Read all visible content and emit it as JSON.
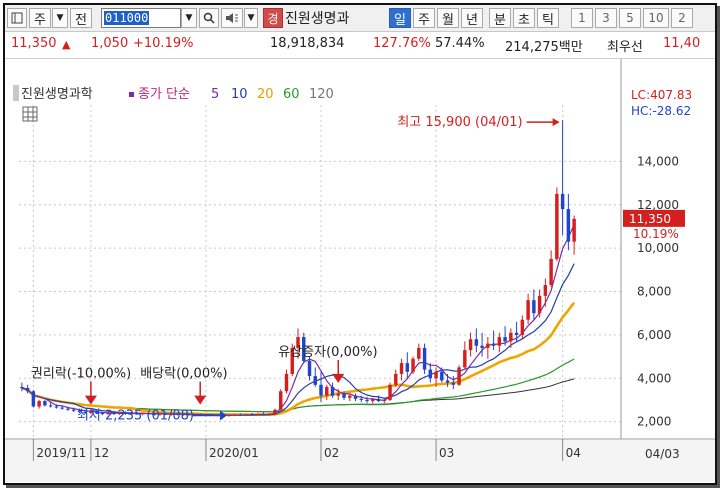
{
  "toolbar": {
    "market_label": "주",
    "mode_label": "전",
    "code_value": "011000",
    "stock_name_tag": "경",
    "stock_name": "진원생명과",
    "timeframes": [
      "일",
      "주",
      "월",
      "년",
      "분",
      "초",
      "틱"
    ],
    "active_timeframe": "일",
    "numbers": [
      "1",
      "3",
      "5",
      "10",
      "2"
    ]
  },
  "quote": {
    "price": "11,350",
    "change": "1,050",
    "change_pct": "+10.19%",
    "volume": "18,918,834",
    "vol_ratio": "127.76%",
    "turnover_pct": "57.44%",
    "trade_value": "214,275백만",
    "pref_label": "최우선",
    "pref_price": "11,40"
  },
  "colors": {
    "up": "#d41f1f",
    "down": "#1f45c8",
    "ma5": "#7a2ca8",
    "ma10": "#1f3fb0",
    "ma20": "#f0a500",
    "ma60": "#2a9a2a",
    "ma120": "#333333"
  },
  "chart_data": {
    "type": "candlestick",
    "title": "진원생명과학",
    "legend": {
      "price_label": "종가 단순",
      "periods": [
        "5",
        "10",
        "20",
        "60",
        "120"
      ]
    },
    "corner_labels": {
      "lc": "LC:407.83",
      "hc": "HC:-28.62"
    },
    "ylim": [
      1200,
      16600
    ],
    "y_ticks": [
      "2,000",
      "4,000",
      "6,000",
      "8,000",
      "10,000",
      "12,000",
      "14,000"
    ],
    "y_tick_values": [
      2000,
      4000,
      6000,
      8000,
      10000,
      12000,
      14000
    ],
    "x_labels": [
      "2019/11",
      "12",
      "2020/01",
      "02",
      "03",
      "04"
    ],
    "x_label_dates": [
      "2019-11-18",
      "2019-12-02",
      "2020-01-02",
      "2020-02-03",
      "2020-03-02",
      "2020-04-01"
    ],
    "right_date_label": "04/03",
    "last_price": "11,350",
    "last_change_pct": "10.19%",
    "last_close_value": 11350,
    "annotations": {
      "high": "최고 15,900 (04/01)",
      "low": "최저 2,235 (01/08)",
      "rights": "권리락(-10.00%)",
      "dividend": "배당락(0,00%)",
      "capital": "유상증자(0,00%)"
    },
    "event_values": {
      "rights": 3200,
      "dividend": 3200,
      "capital": 4200
    },
    "candles": [
      {
        "d": "2019-11-14",
        "o": 3600,
        "h": 3800,
        "l": 3400,
        "c": 3550
      },
      {
        "d": "2019-11-15",
        "o": 3550,
        "h": 3700,
        "l": 3300,
        "c": 3400
      },
      {
        "d": "2019-11-18",
        "o": 3400,
        "h": 3450,
        "l": 2650,
        "c": 2700
      },
      {
        "d": "2019-11-19",
        "o": 2700,
        "h": 3000,
        "l": 2600,
        "c": 2950
      },
      {
        "d": "2019-11-20",
        "o": 2950,
        "h": 3000,
        "l": 2700,
        "c": 2750
      },
      {
        "d": "2019-11-21",
        "o": 2750,
        "h": 2900,
        "l": 2650,
        "c": 2700
      },
      {
        "d": "2019-11-22",
        "o": 2700,
        "h": 2800,
        "l": 2600,
        "c": 2650
      },
      {
        "d": "2019-11-25",
        "o": 2650,
        "h": 2750,
        "l": 2550,
        "c": 2600
      },
      {
        "d": "2019-11-26",
        "o": 2600,
        "h": 2700,
        "l": 2500,
        "c": 2550
      },
      {
        "d": "2019-11-27",
        "o": 2550,
        "h": 2650,
        "l": 2450,
        "c": 2500
      },
      {
        "d": "2019-11-28",
        "o": 2500,
        "h": 2600,
        "l": 2400,
        "c": 2450
      },
      {
        "d": "2019-11-29",
        "o": 2450,
        "h": 2550,
        "l": 2350,
        "c": 2400
      },
      {
        "d": "2019-12-02",
        "o": 2400,
        "h": 2550,
        "l": 2350,
        "c": 2500
      },
      {
        "d": "2019-12-03",
        "o": 2500,
        "h": 2550,
        "l": 2350,
        "c": 2400
      },
      {
        "d": "2019-12-04",
        "o": 2400,
        "h": 2450,
        "l": 2300,
        "c": 2350
      },
      {
        "d": "2019-12-05",
        "o": 2350,
        "h": 2450,
        "l": 2300,
        "c": 2400
      },
      {
        "d": "2019-12-06",
        "o": 2400,
        "h": 2500,
        "l": 2300,
        "c": 2350
      },
      {
        "d": "2019-12-09",
        "o": 2350,
        "h": 2450,
        "l": 2300,
        "c": 2420
      },
      {
        "d": "2019-12-10",
        "o": 2420,
        "h": 2480,
        "l": 2320,
        "c": 2360
      },
      {
        "d": "2019-12-11",
        "o": 2360,
        "h": 2450,
        "l": 2300,
        "c": 2380
      },
      {
        "d": "2019-12-12",
        "o": 2380,
        "h": 2460,
        "l": 2310,
        "c": 2340
      },
      {
        "d": "2019-12-13",
        "o": 2340,
        "h": 2420,
        "l": 2290,
        "c": 2400
      },
      {
        "d": "2019-12-16",
        "o": 2400,
        "h": 2470,
        "l": 2320,
        "c": 2350
      },
      {
        "d": "2019-12-17",
        "o": 2350,
        "h": 2420,
        "l": 2280,
        "c": 2330
      },
      {
        "d": "2019-12-18",
        "o": 2330,
        "h": 2400,
        "l": 2270,
        "c": 2370
      },
      {
        "d": "2019-12-19",
        "o": 2370,
        "h": 2430,
        "l": 2300,
        "c": 2320
      },
      {
        "d": "2019-12-20",
        "o": 2320,
        "h": 2400,
        "l": 2280,
        "c": 2360
      },
      {
        "d": "2019-12-23",
        "o": 2360,
        "h": 2420,
        "l": 2290,
        "c": 2310
      },
      {
        "d": "2019-12-24",
        "o": 2310,
        "h": 2380,
        "l": 2260,
        "c": 2340
      },
      {
        "d": "2019-12-26",
        "o": 2340,
        "h": 2400,
        "l": 2280,
        "c": 2300
      },
      {
        "d": "2019-12-27",
        "o": 2300,
        "h": 2360,
        "l": 2250,
        "c": 2320
      },
      {
        "d": "2019-12-30",
        "o": 2320,
        "h": 2380,
        "l": 2260,
        "c": 2290
      },
      {
        "d": "2020-01-02",
        "o": 2290,
        "h": 2350,
        "l": 2250,
        "c": 2310
      },
      {
        "d": "2020-01-03",
        "o": 2310,
        "h": 2360,
        "l": 2260,
        "c": 2280
      },
      {
        "d": "2020-01-06",
        "o": 2280,
        "h": 2330,
        "l": 2250,
        "c": 2300
      },
      {
        "d": "2020-01-07",
        "o": 2300,
        "h": 2350,
        "l": 2250,
        "c": 2270
      },
      {
        "d": "2020-01-08",
        "o": 2270,
        "h": 2320,
        "l": 2235,
        "c": 2300
      },
      {
        "d": "2020-01-09",
        "o": 2300,
        "h": 2360,
        "l": 2260,
        "c": 2330
      },
      {
        "d": "2020-01-10",
        "o": 2330,
        "h": 2380,
        "l": 2280,
        "c": 2300
      },
      {
        "d": "2020-01-13",
        "o": 2300,
        "h": 2360,
        "l": 2270,
        "c": 2340
      },
      {
        "d": "2020-01-14",
        "o": 2340,
        "h": 2400,
        "l": 2290,
        "c": 2320
      },
      {
        "d": "2020-01-15",
        "o": 2320,
        "h": 2380,
        "l": 2280,
        "c": 2350
      },
      {
        "d": "2020-01-16",
        "o": 2350,
        "h": 2420,
        "l": 2300,
        "c": 2330
      },
      {
        "d": "2020-01-17",
        "o": 2330,
        "h": 2400,
        "l": 2290,
        "c": 2360
      },
      {
        "d": "2020-01-20",
        "o": 2360,
        "h": 2600,
        "l": 2320,
        "c": 2550
      },
      {
        "d": "2020-01-21",
        "o": 2550,
        "h": 3500,
        "l": 2500,
        "c": 3400
      },
      {
        "d": "2020-01-22",
        "o": 3400,
        "h": 4400,
        "l": 3300,
        "c": 4200
      },
      {
        "d": "2020-01-23",
        "o": 4200,
        "h": 5600,
        "l": 4100,
        "c": 5400
      },
      {
        "d": "2020-01-28",
        "o": 5400,
        "h": 6300,
        "l": 4900,
        "c": 5900
      },
      {
        "d": "2020-01-29",
        "o": 5900,
        "h": 6100,
        "l": 4700,
        "c": 4800
      },
      {
        "d": "2020-01-30",
        "o": 4800,
        "h": 5000,
        "l": 3900,
        "c": 4100
      },
      {
        "d": "2020-01-31",
        "o": 4100,
        "h": 4500,
        "l": 3600,
        "c": 3700
      },
      {
        "d": "2020-02-03",
        "o": 3700,
        "h": 4300,
        "l": 2900,
        "c": 3200
      },
      {
        "d": "2020-02-04",
        "o": 3200,
        "h": 3700,
        "l": 3000,
        "c": 3600
      },
      {
        "d": "2020-02-05",
        "o": 3600,
        "h": 3800,
        "l": 3100,
        "c": 3200
      },
      {
        "d": "2020-02-06",
        "o": 3200,
        "h": 3500,
        "l": 3000,
        "c": 3300
      },
      {
        "d": "2020-02-07",
        "o": 3300,
        "h": 3400,
        "l": 3000,
        "c": 3100
      },
      {
        "d": "2020-02-10",
        "o": 3100,
        "h": 3300,
        "l": 2950,
        "c": 3200
      },
      {
        "d": "2020-02-11",
        "o": 3200,
        "h": 3300,
        "l": 2950,
        "c": 3050
      },
      {
        "d": "2020-02-12",
        "o": 3050,
        "h": 3200,
        "l": 2900,
        "c": 3000
      },
      {
        "d": "2020-02-13",
        "o": 3000,
        "h": 3150,
        "l": 2850,
        "c": 2950
      },
      {
        "d": "2020-02-14",
        "o": 2950,
        "h": 3100,
        "l": 2850,
        "c": 3050
      },
      {
        "d": "2020-02-17",
        "o": 3050,
        "h": 3200,
        "l": 2900,
        "c": 2950
      },
      {
        "d": "2020-02-18",
        "o": 2950,
        "h": 3100,
        "l": 2850,
        "c": 3000
      },
      {
        "d": "2020-02-19",
        "o": 3000,
        "h": 3800,
        "l": 2950,
        "c": 3700
      },
      {
        "d": "2020-02-20",
        "o": 3700,
        "h": 4400,
        "l": 3600,
        "c": 4200
      },
      {
        "d": "2020-02-21",
        "o": 4200,
        "h": 4900,
        "l": 3900,
        "c": 4700
      },
      {
        "d": "2020-02-24",
        "o": 4700,
        "h": 5200,
        "l": 4000,
        "c": 4300
      },
      {
        "d": "2020-02-25",
        "o": 4300,
        "h": 5000,
        "l": 4200,
        "c": 4900
      },
      {
        "d": "2020-02-26",
        "o": 4900,
        "h": 5600,
        "l": 4800,
        "c": 5400
      },
      {
        "d": "2020-02-27",
        "o": 5400,
        "h": 5600,
        "l": 4200,
        "c": 4400
      },
      {
        "d": "2020-02-28",
        "o": 4400,
        "h": 4700,
        "l": 3800,
        "c": 4000
      },
      {
        "d": "2020-03-02",
        "o": 4000,
        "h": 4500,
        "l": 3600,
        "c": 4300
      },
      {
        "d": "2020-03-03",
        "o": 4300,
        "h": 4500,
        "l": 3800,
        "c": 3900
      },
      {
        "d": "2020-03-04",
        "o": 3900,
        "h": 4200,
        "l": 3600,
        "c": 3800
      },
      {
        "d": "2020-03-05",
        "o": 3800,
        "h": 4100,
        "l": 3500,
        "c": 3700
      },
      {
        "d": "2020-03-06",
        "o": 3700,
        "h": 4600,
        "l": 3650,
        "c": 4500
      },
      {
        "d": "2020-03-09",
        "o": 4500,
        "h": 5700,
        "l": 4400,
        "c": 5300
      },
      {
        "d": "2020-03-10",
        "o": 5300,
        "h": 6100,
        "l": 5000,
        "c": 5800
      },
      {
        "d": "2020-03-11",
        "o": 5800,
        "h": 6300,
        "l": 5200,
        "c": 5500
      },
      {
        "d": "2020-03-12",
        "o": 5500,
        "h": 6100,
        "l": 5000,
        "c": 5400
      },
      {
        "d": "2020-03-13",
        "o": 5400,
        "h": 5900,
        "l": 4900,
        "c": 5600
      },
      {
        "d": "2020-03-16",
        "o": 5600,
        "h": 6200,
        "l": 5300,
        "c": 5500
      },
      {
        "d": "2020-03-17",
        "o": 5500,
        "h": 6100,
        "l": 5200,
        "c": 5900
      },
      {
        "d": "2020-03-18",
        "o": 5900,
        "h": 6400,
        "l": 5500,
        "c": 5700
      },
      {
        "d": "2020-03-19",
        "o": 5700,
        "h": 6300,
        "l": 5400,
        "c": 6100
      },
      {
        "d": "2020-03-20",
        "o": 6100,
        "h": 6600,
        "l": 5700,
        "c": 6000
      },
      {
        "d": "2020-03-23",
        "o": 6000,
        "h": 6900,
        "l": 5800,
        "c": 6700
      },
      {
        "d": "2020-03-24",
        "o": 6700,
        "h": 7900,
        "l": 6500,
        "c": 7600
      },
      {
        "d": "2020-03-25",
        "o": 7600,
        "h": 8100,
        "l": 6700,
        "c": 7000
      },
      {
        "d": "2020-03-26",
        "o": 7000,
        "h": 8100,
        "l": 6800,
        "c": 7800
      },
      {
        "d": "2020-03-27",
        "o": 7800,
        "h": 8600,
        "l": 7300,
        "c": 8300
      },
      {
        "d": "2020-03-30",
        "o": 8300,
        "h": 9900,
        "l": 8200,
        "c": 9500
      },
      {
        "d": "2020-03-31",
        "o": 9500,
        "h": 12800,
        "l": 9400,
        "c": 12500
      },
      {
        "d": "2020-04-01",
        "o": 12500,
        "h": 15900,
        "l": 10600,
        "c": 11800
      },
      {
        "d": "2020-04-02",
        "o": 11800,
        "h": 12500,
        "l": 9900,
        "c": 10300
      },
      {
        "d": "2020-04-03",
        "o": 10300,
        "h": 11500,
        "l": 9700,
        "c": 11350
      }
    ]
  }
}
